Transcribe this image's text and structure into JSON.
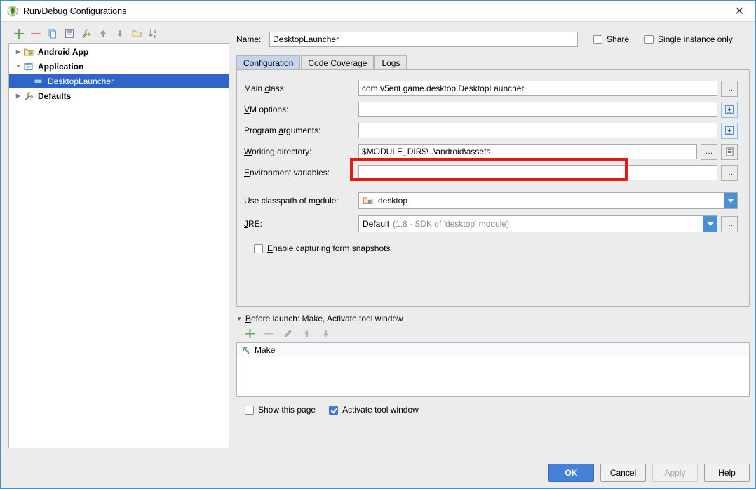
{
  "window": {
    "title": "Run/Debug Configurations",
    "app_icon": "intellij-idea-icon",
    "close_label": "✕"
  },
  "tree_toolbar": {
    "buttons": [
      {
        "name": "add-configuration-button",
        "icon": "plus-icon",
        "label": "+"
      },
      {
        "name": "remove-configuration-button",
        "icon": "minus-icon",
        "label": "−"
      },
      {
        "name": "copy-configuration-button",
        "icon": "copy-icon",
        "label": ""
      },
      {
        "name": "save-configuration-button",
        "icon": "save-icon",
        "label": ""
      },
      {
        "name": "edit-defaults-button",
        "icon": "wrench-icon",
        "label": ""
      },
      {
        "name": "move-up-button",
        "icon": "arrow-up-icon",
        "label": ""
      },
      {
        "name": "move-down-button",
        "icon": "arrow-down-icon",
        "label": ""
      },
      {
        "name": "new-folder-button",
        "icon": "folder-icon",
        "label": ""
      },
      {
        "name": "sort-alphabetically-button",
        "icon": "sort-az-icon",
        "label": ""
      }
    ]
  },
  "tree": {
    "items": [
      {
        "label": "Android App",
        "icon": "android-app-icon",
        "twisty": "▶",
        "level": 1,
        "bold": true,
        "selected": false
      },
      {
        "label": "Application",
        "icon": "application-icon",
        "twisty": "▼",
        "level": 1,
        "bold": true,
        "selected": false
      },
      {
        "label": "DesktopLauncher",
        "icon": "run-config-icon",
        "twisty": "",
        "level": 2,
        "bold": false,
        "selected": true
      },
      {
        "label": "Defaults",
        "icon": "defaults-icon",
        "twisty": "▶",
        "level": 1,
        "bold": true,
        "selected": false
      }
    ]
  },
  "name_row": {
    "label": "Name:",
    "value": "DesktopLauncher",
    "placeholder": "",
    "share": {
      "label": "Share",
      "checked": false
    },
    "single_instance": {
      "label": "Single instance only",
      "checked": false
    }
  },
  "tabs": [
    {
      "label": "Configuration",
      "active": true
    },
    {
      "label": "Code Coverage",
      "active": false
    },
    {
      "label": "Logs",
      "active": false
    }
  ],
  "configuration": {
    "main_class": {
      "label": "Main class:",
      "value": "com.v5ent.game.desktop.DesktopLauncher",
      "browse_label": "…"
    },
    "vm_options": {
      "label": "VM options:",
      "value": "",
      "expand_label": "⤓"
    },
    "program_arguments": {
      "label": "Program arguments:",
      "value": "",
      "expand_label": "⤓"
    },
    "working_directory": {
      "label": "Working directory:",
      "value": "$MODULE_DIR$\\..\\android\\assets",
      "browse_label": "…",
      "macro_label": "≡",
      "highlighted": true
    },
    "environment_variables": {
      "label": "Environment variables:",
      "value": "",
      "browse_label": "…"
    },
    "use_classpath_of_module": {
      "label": "Use classpath of module:",
      "value": "desktop",
      "icon": "module-icon"
    },
    "jre": {
      "label": "JRE:",
      "value": "Default",
      "value_hint": "(1.8 - SDK of 'desktop' module)",
      "browse_label": "…"
    },
    "enable_capturing": {
      "label": "Enable capturing form snapshots",
      "checked": false
    }
  },
  "before_launch": {
    "title": "Before launch: Make, Activate tool window",
    "twisty": "▼",
    "toolbar": [
      {
        "name": "before-launch-add-button",
        "icon": "plus-icon",
        "label": "+"
      },
      {
        "name": "before-launch-remove-button",
        "icon": "minus-icon",
        "label": "−"
      },
      {
        "name": "before-launch-edit-button",
        "icon": "pencil-icon",
        "label": ""
      },
      {
        "name": "before-launch-move-up-button",
        "icon": "arrow-up-icon",
        "label": ""
      },
      {
        "name": "before-launch-move-down-button",
        "icon": "arrow-down-icon",
        "label": ""
      }
    ],
    "items": [
      {
        "label": "Make",
        "icon": "make-icon"
      }
    ],
    "show_this_page": {
      "label": "Show this page",
      "checked": false
    },
    "activate_tool_window": {
      "label": "Activate tool window",
      "checked": true
    }
  },
  "footer": {
    "ok": "OK",
    "cancel": "Cancel",
    "apply": "Apply",
    "help": "Help"
  },
  "colors": {
    "accent_blue": "#4680d8",
    "selection_blue": "#2f65c8",
    "highlight_red": "#e61919",
    "tab_active": "#c4d6ef",
    "window_border": "#4a90c4"
  }
}
